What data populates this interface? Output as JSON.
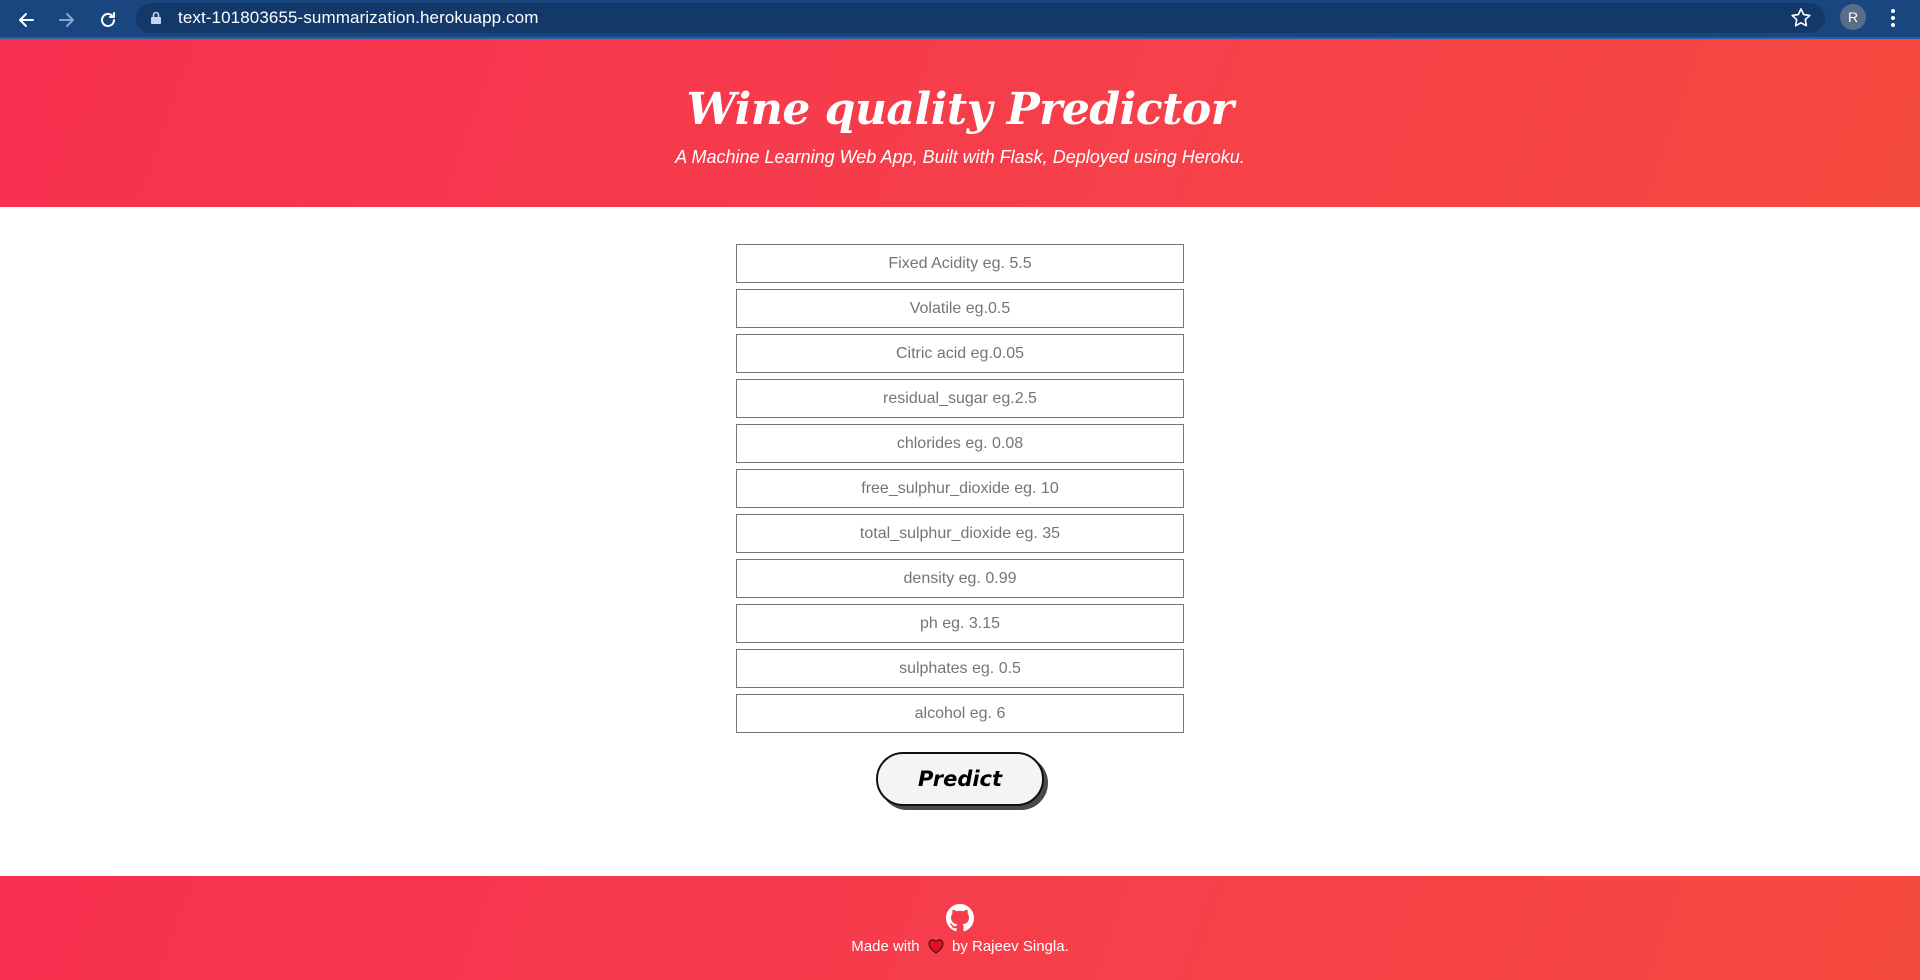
{
  "browser": {
    "url": "text-101803655-summarization.herokuapp.com",
    "profile_initial": "R",
    "icons": [
      "back-icon",
      "forward-icon",
      "reload-icon",
      "lock-icon",
      "star-icon",
      "menu-icon"
    ]
  },
  "header": {
    "title": "Wine quality Predictor",
    "subtitle": "A Machine Learning Web App, Built with Flask, Deployed using Heroku."
  },
  "form": {
    "fields": [
      {
        "placeholder": "Fixed Acidity eg. 5.5",
        "value": ""
      },
      {
        "placeholder": "Volatile eg.0.5",
        "value": ""
      },
      {
        "placeholder": "Citric acid eg.0.05",
        "value": ""
      },
      {
        "placeholder": "residual_sugar eg.2.5",
        "value": ""
      },
      {
        "placeholder": "chlorides eg. 0.08",
        "value": ""
      },
      {
        "placeholder": "free_sulphur_dioxide eg. 10",
        "value": ""
      },
      {
        "placeholder": "total_sulphur_dioxide eg. 35",
        "value": ""
      },
      {
        "placeholder": "density eg. 0.99",
        "value": ""
      },
      {
        "placeholder": "ph eg. 3.15",
        "value": ""
      },
      {
        "placeholder": "sulphates eg. 0.5",
        "value": ""
      },
      {
        "placeholder": "alcohol eg. 6",
        "value": ""
      }
    ],
    "submit_label": "Predict"
  },
  "footer": {
    "made_with": "Made with",
    "by": "by Rajeev Singla.",
    "icons": [
      "github-icon",
      "heart-icon"
    ]
  },
  "colors": {
    "chrome": "#1a4680",
    "banner_start": "#f7304f",
    "banner_end": "#f54a3f",
    "heart": "#e0101e"
  }
}
